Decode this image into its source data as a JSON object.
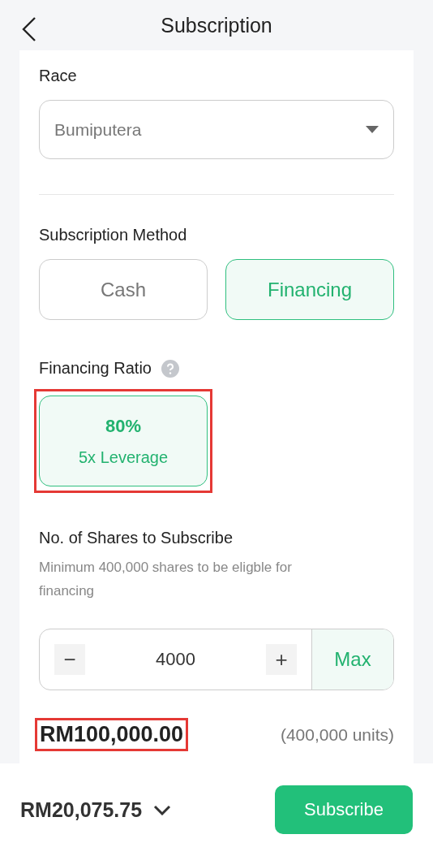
{
  "header": {
    "title": "Subscription"
  },
  "race": {
    "label": "Race",
    "value": "Bumiputera"
  },
  "method": {
    "label": "Subscription Method",
    "options": [
      {
        "label": "Cash",
        "selected": false
      },
      {
        "label": "Financing",
        "selected": true
      }
    ]
  },
  "ratio": {
    "label": "Financing Ratio",
    "options": [
      {
        "percent": "80%",
        "leverage": "5x Leverage",
        "selected": true,
        "highlighted": true
      }
    ]
  },
  "shares": {
    "label": "No. of Shares to Subscribe",
    "hint": "Minimum 400,000 shares to be eligble for financing",
    "minus": "−",
    "value": "4000",
    "plus": "+",
    "max": "Max"
  },
  "amount": {
    "value": "RM100,000.00",
    "highlighted": true,
    "units": "(400,000 units)"
  },
  "footer": {
    "balance": "RM20,075.75",
    "button": "Subscribe"
  }
}
